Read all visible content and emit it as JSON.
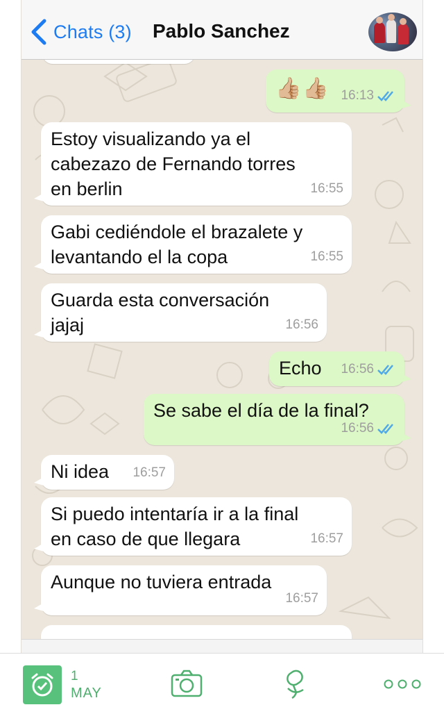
{
  "header": {
    "back_label": "Chats (3)",
    "title": "Pablo Sanchez"
  },
  "colors": {
    "accent": "#1e7cf2",
    "outgoing_bubble": "#dcf8c6",
    "incoming_bubble": "#ffffff",
    "chat_background": "#ece6dc",
    "read_ticks": "#4fa8e8",
    "bottom_bar_green": "#4faf6e"
  },
  "messages": [
    {
      "direction": "out",
      "lines": [
        "👍🏼👍🏼"
      ],
      "time": "16:13",
      "read": true
    },
    {
      "direction": "in",
      "lines": [
        "Estoy visualizando ya el",
        "cabezazo de Fernando torres",
        "en berlin"
      ],
      "time": "16:55"
    },
    {
      "direction": "in",
      "lines": [
        "Gabi cediéndole el brazalete y",
        "levantando el la copa"
      ],
      "time": "16:55"
    },
    {
      "direction": "in",
      "lines": [
        "Guarda esta conversación",
        "jajaj"
      ],
      "time": "16:56"
    },
    {
      "direction": "out",
      "lines": [
        "Echo"
      ],
      "time": "16:56",
      "read": true
    },
    {
      "direction": "out",
      "lines": [
        "Se sabe el día de la final?"
      ],
      "time": "16:56",
      "read": true
    },
    {
      "direction": "in",
      "lines": [
        "Ni idea"
      ],
      "time": "16:57"
    },
    {
      "direction": "in",
      "lines": [
        "Si puedo intentaría ir a la final",
        "en caso de que llegara"
      ],
      "time": "16:57"
    },
    {
      "direction": "in",
      "lines": [
        "Aunque no tuviera entrada"
      ],
      "time": "16:57"
    }
  ],
  "bottom_bar": {
    "date_day": "1",
    "date_month": "MAY",
    "icons": [
      "alarm-icon",
      "camera-icon",
      "microphone-icon",
      "more-icon"
    ]
  }
}
